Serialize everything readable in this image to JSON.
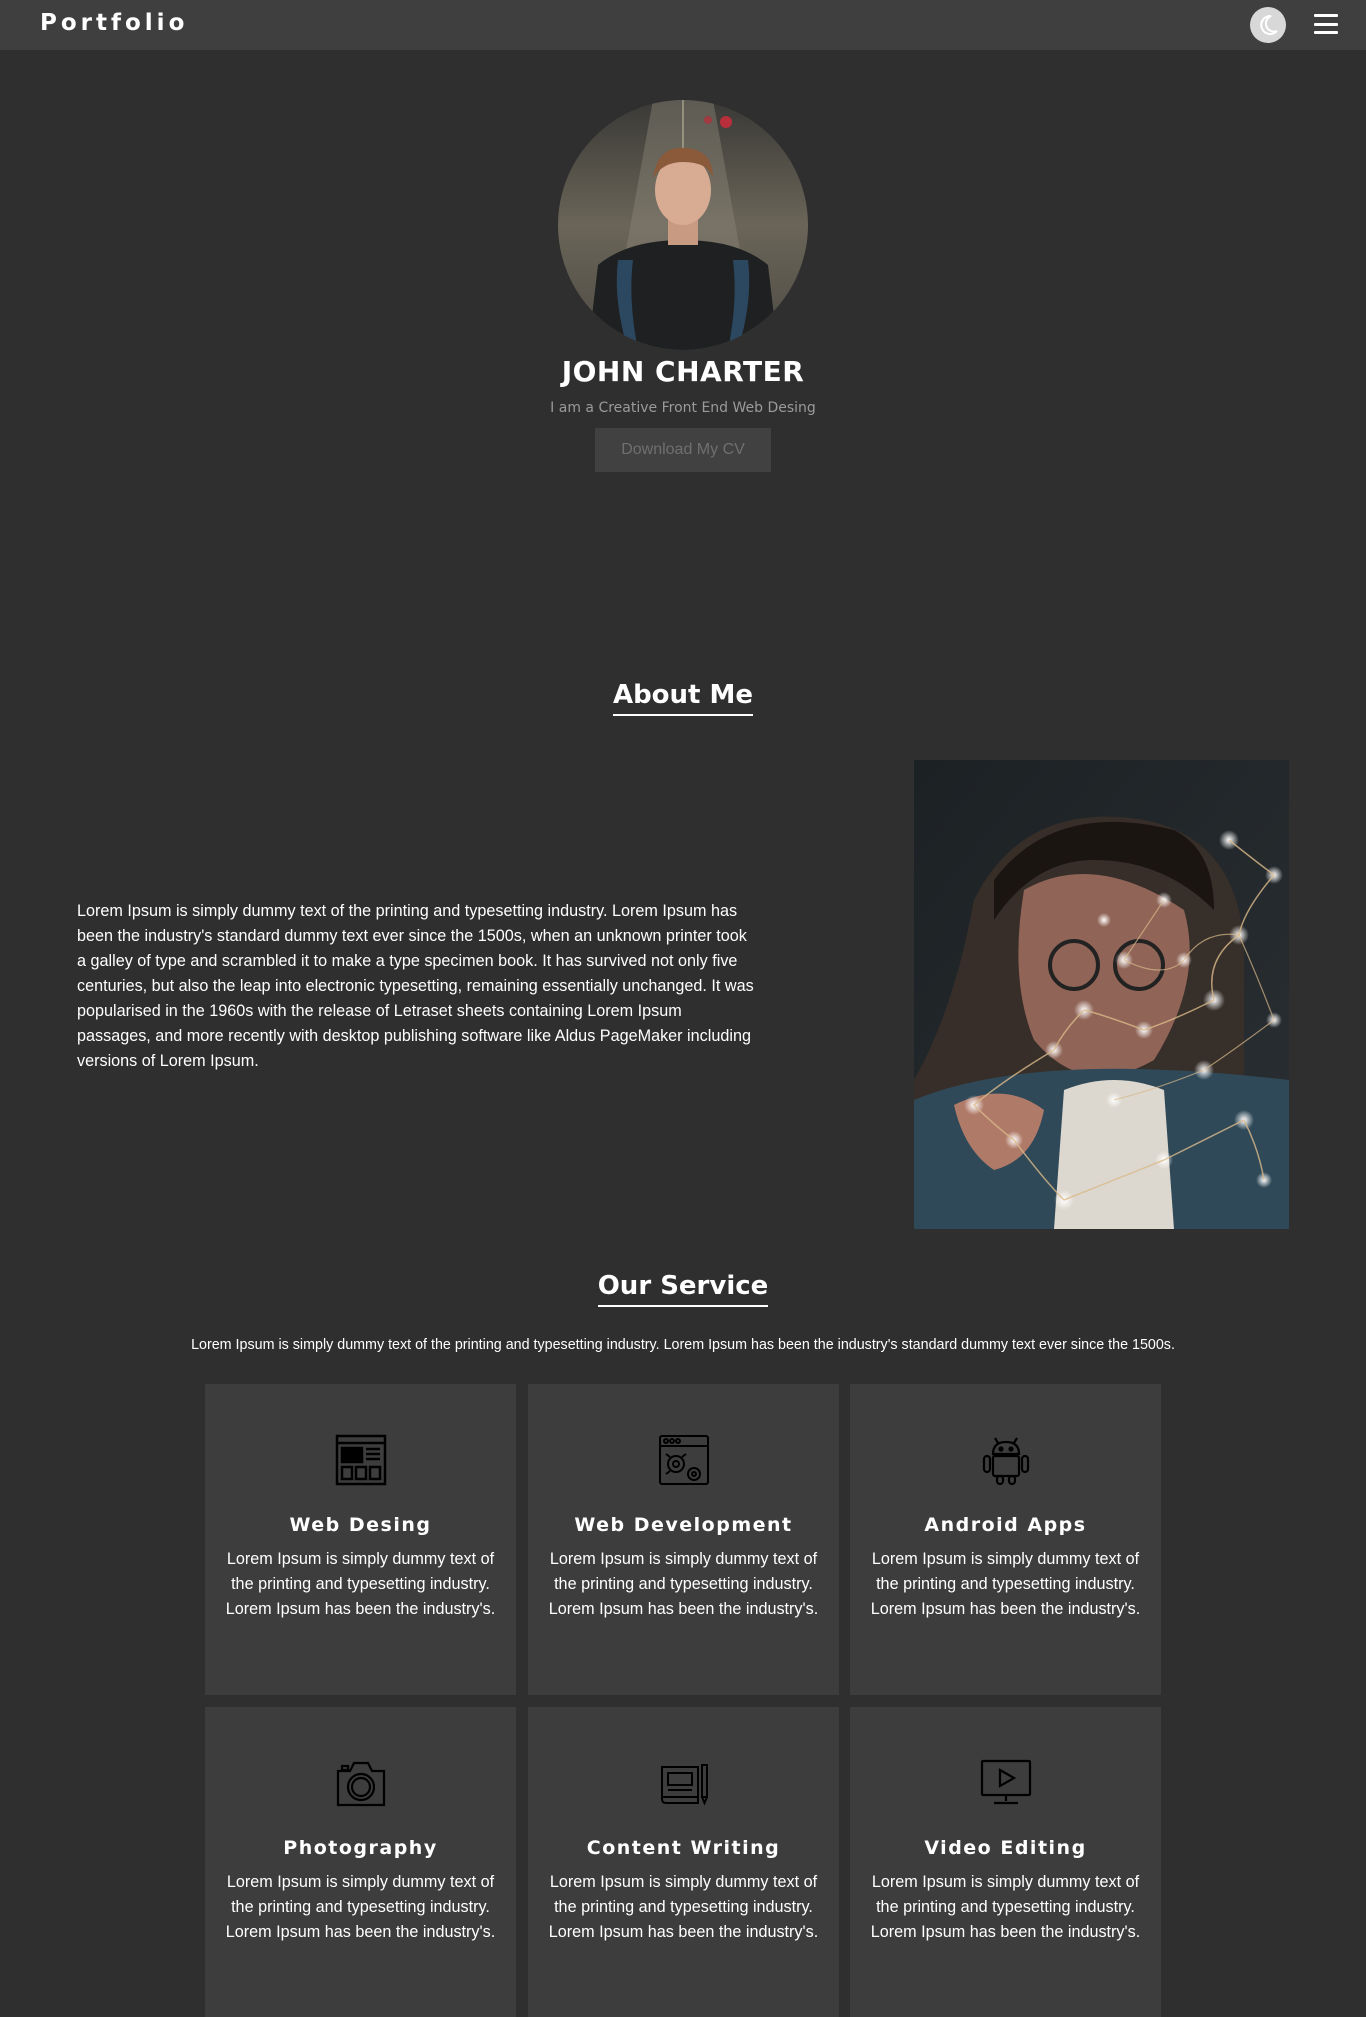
{
  "nav": {
    "brand": "Portfolio",
    "theme_icon": "moon-icon",
    "menu_icon": "hamburger-icon"
  },
  "hero": {
    "name": "JOHN CHARTER",
    "subtitle": "I am a Creative Front End Web Desing",
    "cv_button": "Download My CV"
  },
  "about": {
    "title": "About Me",
    "text": "Lorem Ipsum is simply dummy text of the printing and typesetting industry. Lorem Ipsum has been the industry's standard dummy text ever since the 1500s, when an unknown printer took a galley of type and scrambled it to make a type specimen book. It has survived not only five centuries, but also the leap into electronic typesetting, remaining essentially unchanged. It was popularised in the 1960s with the release of Letraset sheets containing Lorem Ipsum passages, and more recently with desktop publishing software like Aldus PageMaker including versions of Lorem Ipsum."
  },
  "services": {
    "title": "Our Service",
    "intro": "Lorem Ipsum is simply dummy text of the printing and typesetting industry. Lorem Ipsum has been the industry's standard dummy text ever since the 1500s.",
    "items": [
      {
        "title": "Web Desing",
        "icon": "web-design-icon",
        "text": "Lorem Ipsum is simply dummy text of the printing and typesetting industry. Lorem Ipsum has been the industry's."
      },
      {
        "title": "Web Development",
        "icon": "web-development-icon",
        "text": "Lorem Ipsum is simply dummy text of the printing and typesetting industry. Lorem Ipsum has been the industry's."
      },
      {
        "title": "Android Apps",
        "icon": "android-icon",
        "text": "Lorem Ipsum is simply dummy text of the printing and typesetting industry. Lorem Ipsum has been the industry's."
      },
      {
        "title": "Photography",
        "icon": "camera-icon",
        "text": "Lorem Ipsum is simply dummy text of the printing and typesetting industry. Lorem Ipsum has been the industry's."
      },
      {
        "title": "Content Writing",
        "icon": "content-writing-icon",
        "text": "Lorem Ipsum is simply dummy text of the printing and typesetting industry. Lorem Ipsum has been the industry's."
      },
      {
        "title": "Video Editing",
        "icon": "video-editing-icon",
        "text": "Lorem Ipsum is simply dummy text of the printing and typesetting industry. Lorem Ipsum has been the industry's."
      }
    ]
  },
  "colors": {
    "background": "#2f2f2f",
    "navbar": "#3f3f3f",
    "card": "#3d3d3d",
    "text": "#ffffff",
    "muted": "#9a9a9a"
  }
}
